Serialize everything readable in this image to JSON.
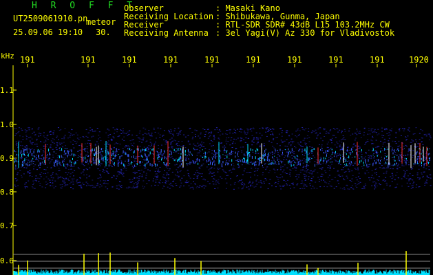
{
  "header": {
    "brand": "H R O F F T",
    "filename": "UT2509061910.pn",
    "meteor_label": "meteor",
    "datetime": "25.09.06 19:10",
    "interval": "30.",
    "fields": [
      {
        "label": "Observer",
        "value": ": Masaki Kano"
      },
      {
        "label": "Receiving Location",
        "value": ": Shibukawa, Gunma, Japan"
      },
      {
        "label": "Receiver",
        "value": ": RTL-SDR SDR# 43dB L15 103.2MHz CW"
      },
      {
        "label": "Receiving Antenna",
        "value": ": 3el Yagi(V) Az 330 for Vladivostok"
      }
    ]
  },
  "spectrogram": {
    "unit": "kHz",
    "x_ticks": [
      "191",
      "191",
      "191",
      "191",
      "191",
      "191",
      "191",
      "191",
      "191",
      "1920"
    ],
    "y_ticks": [
      "1.1",
      "1.0",
      "0.9",
      "0.8",
      "0.7",
      "0.6"
    ],
    "band_center_khz": 0.91,
    "colors": {
      "axis": "#ffff00",
      "band": "#1a1aa0",
      "echo": "#00e0ff",
      "strong": "#ff3030",
      "baseline": "#00e0ff"
    }
  }
}
